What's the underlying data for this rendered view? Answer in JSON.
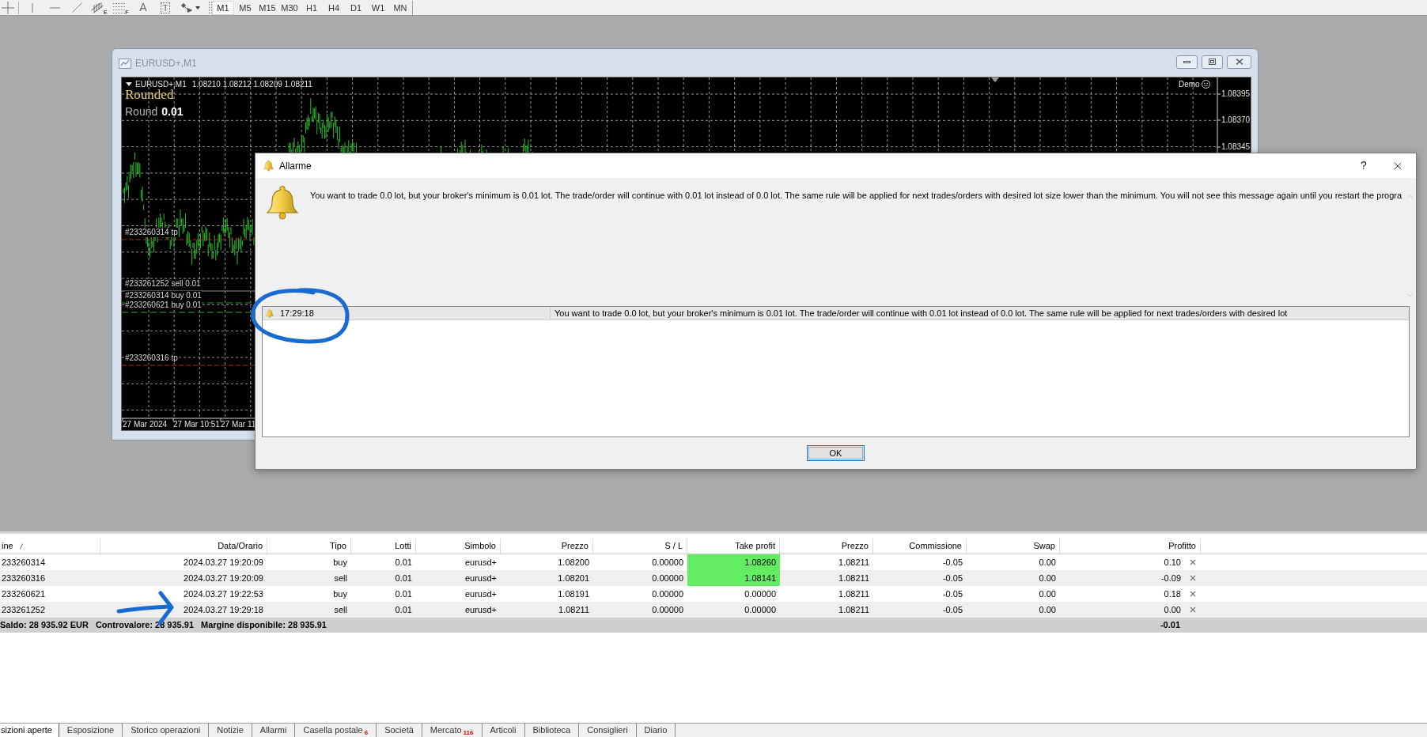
{
  "toolbar": {
    "tools": [
      {
        "kind": "crosshair"
      },
      {
        "kind": "vertical_line"
      },
      {
        "kind": "horizontal_line"
      },
      {
        "kind": "trendline"
      },
      {
        "kind": "channel",
        "glyph": "E"
      },
      {
        "kind": "fibonacci",
        "glyph": "F"
      },
      {
        "kind": "text",
        "glyph": "A"
      },
      {
        "kind": "text_label",
        "glyph": "T"
      },
      {
        "kind": "arrows"
      }
    ],
    "timeframes": [
      {
        "label": "M1",
        "selected": true
      },
      {
        "label": "M5",
        "selected": false
      },
      {
        "label": "M15",
        "selected": false
      },
      {
        "label": "M30",
        "selected": false
      },
      {
        "label": "H1",
        "selected": false
      },
      {
        "label": "H4",
        "selected": false
      },
      {
        "label": "D1",
        "selected": false
      },
      {
        "label": "W1",
        "selected": false
      },
      {
        "label": "MN",
        "selected": false
      }
    ]
  },
  "chart_window": {
    "title": "EURUSD+,M1",
    "chart": {
      "symbol": "EURUSD+,M1",
      "quotes": "1.08210 1.08212 1.08209 1.08211",
      "indicator": {
        "name": "Rounded",
        "label": "Round",
        "value": "0.01"
      },
      "account_type": "Demo",
      "price_scale": [
        "1.08395",
        "1.08370",
        "1.08345"
      ],
      "trade_labels": [
        {
          "text": "#233260314 tp",
          "kind": "tp"
        },
        {
          "text": "#233261252 sell 0.01",
          "kind": "sell"
        },
        {
          "text": "#233260314 buy 0.01",
          "kind": "buy"
        },
        {
          "text": "#233260621 buy 0.01",
          "kind": "buy"
        },
        {
          "text": "#233260316 tp",
          "kind": "tp"
        }
      ],
      "time_scale": [
        "27 Mar 2024",
        "27 Mar 10:51",
        "27 Mar 11"
      ]
    }
  },
  "alert_dialog": {
    "title": "Allarme",
    "help_button": "?",
    "message": "You want to trade 0.0 lot, but your broker's minimum is 0.01 lot. The trade/order will continue with 0.01 lot instead of 0.0 lot. The same rule will be applied for next trades/orders with desired lot size lower than the minimum. You will not see this message again until you restart the progra",
    "log": [
      {
        "time": "17:29:18",
        "message": "You want to trade 0.0 lot, but your broker's minimum is 0.01 lot. The trade/order will continue with 0.01 lot instead of 0.0 lot. The same rule will be applied for next trades/orders with desired lot",
        "selected": true
      }
    ],
    "ok_button": "OK"
  },
  "terminal": {
    "columns": [
      {
        "label": "ine",
        "sorted": true
      },
      {
        "label": "Data/Orario",
        "sorted": false
      },
      {
        "label": "Tipo",
        "sorted": false
      },
      {
        "label": "Lotti",
        "sorted": false
      },
      {
        "label": "Simbolo",
        "sorted": false
      },
      {
        "label": "Prezzo",
        "sorted": false
      },
      {
        "label": "S / L",
        "sorted": false
      },
      {
        "label": "Take profit",
        "sorted": false
      },
      {
        "label": "Prezzo",
        "sorted": false
      },
      {
        "label": "Commissione",
        "sorted": false
      },
      {
        "label": "Swap",
        "sorted": false
      },
      {
        "label": "Profitto",
        "sorted": false
      }
    ],
    "rows": [
      {
        "cells": [
          "233260314",
          "2024.03.27 19:20:09",
          "buy",
          "0.01",
          "eurusd+",
          "1.08200",
          "0.00000",
          "1.08260",
          "1.08211",
          "-0.05",
          "0.00",
          "0.10"
        ],
        "tp_set": true
      },
      {
        "cells": [
          "233260316",
          "2024.03.27 19:20:09",
          "sell",
          "0.01",
          "eurusd+",
          "1.08201",
          "0.00000",
          "1.08141",
          "1.08211",
          "-0.05",
          "0.00",
          "-0.09"
        ],
        "tp_set": true
      },
      {
        "cells": [
          "233260621",
          "2024.03.27 19:22:53",
          "buy",
          "0.01",
          "eurusd+",
          "1.08191",
          "0.00000",
          "0.00000",
          "1.08211",
          "-0.05",
          "0.00",
          "0.18"
        ],
        "tp_set": false
      },
      {
        "cells": [
          "233261252",
          "2024.03.27 19:29:18",
          "sell",
          "0.01",
          "eurusd+",
          "1.08211",
          "0.00000",
          "0.00000",
          "1.08211",
          "-0.05",
          "0.00",
          "0.00"
        ],
        "tp_set": false
      }
    ],
    "summary": {
      "balance": "Saldo: 28 935.92 EUR",
      "equity": "Controvalore: 28 935.91",
      "free_margin": "Margine disponibile: 28 935.91",
      "total_profit": "-0.01"
    },
    "tabs": [
      {
        "label": "sizioni aperte",
        "selected": true
      },
      {
        "label": "Esposizione",
        "selected": false
      },
      {
        "label": "Storico operazioni",
        "selected": false
      },
      {
        "label": "Notizie",
        "selected": false
      },
      {
        "label": "Allarmi",
        "selected": false
      },
      {
        "label": "Casella postale",
        "count": "6",
        "selected": false
      },
      {
        "label": "Società",
        "selected": false
      },
      {
        "label": "Mercato",
        "count": "116",
        "selected": false
      },
      {
        "label": "Articoli",
        "selected": false
      },
      {
        "label": "Biblioteca",
        "selected": false
      },
      {
        "label": "Consiglieri",
        "selected": false
      },
      {
        "label": "Diario",
        "selected": false
      }
    ]
  }
}
